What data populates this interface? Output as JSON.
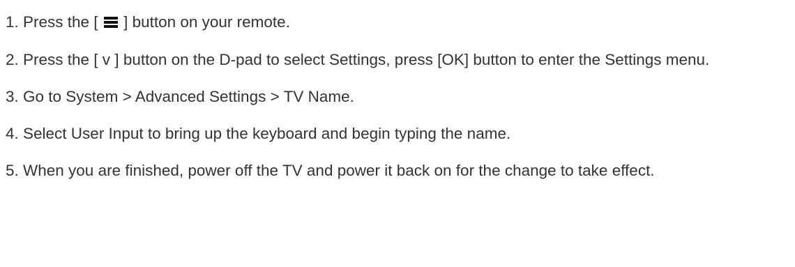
{
  "steps": [
    {
      "before_icon": "1. Press the [ ",
      "icon": "menu-icon",
      "after_icon": " ] button on your remote."
    },
    {
      "text": "2. Press the [ v ] button on the D-pad to select Settings, press [OK] button to enter the Settings menu."
    },
    {
      "text": "3. Go to System > Advanced Settings > TV Name."
    },
    {
      "text": "4. Select User Input to bring up the keyboard and begin typing the name."
    },
    {
      "text": "5. When you are finished, power off the TV and power it back on for the change to take effect."
    }
  ]
}
